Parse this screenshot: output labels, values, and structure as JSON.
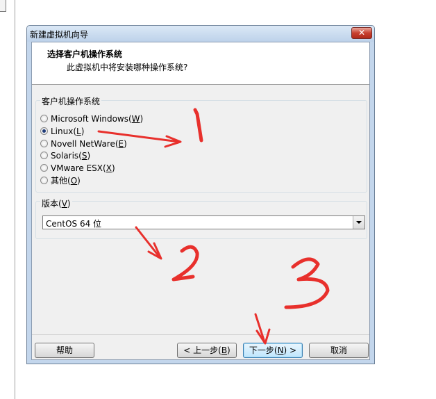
{
  "dialog": {
    "title": "新建虚拟机向导",
    "close_label": "✕",
    "heading": "选择客户机操作系统",
    "subheading": "此虚拟机中将安装哪种操作系统?"
  },
  "os_group": {
    "title": "客户机操作系统",
    "options": [
      {
        "label": "Microsoft Windows(",
        "key": "W",
        "end": ")",
        "checked": false
      },
      {
        "label": "Linux(",
        "key": "L",
        "end": ")",
        "checked": true
      },
      {
        "label": "Novell NetWare(",
        "key": "E",
        "end": ")",
        "checked": false
      },
      {
        "label": "Solaris(",
        "key": "S",
        "end": ")",
        "checked": false
      },
      {
        "label": "VMware ESX(",
        "key": "X",
        "end": ")",
        "checked": false
      },
      {
        "label": "其他(",
        "key": "O",
        "end": ")",
        "checked": false
      }
    ]
  },
  "version_group": {
    "title_pre": "版本(",
    "title_key": "V",
    "title_end": ")",
    "selected": "CentOS 64 位"
  },
  "buttons": {
    "help": "帮助",
    "back_pre": "< 上一步(",
    "back_key": "B",
    "back_end": ")",
    "next_pre": "下一步(",
    "next_key": "N",
    "next_end": ") >",
    "cancel": "取消"
  },
  "annotations": {
    "color": "#e8302c",
    "numbers": [
      "1",
      "2",
      "3"
    ]
  },
  "colors": {
    "title_bar": "#c9dbef",
    "close_button": "#c8402f",
    "client_bg": "#f0f0f0"
  }
}
